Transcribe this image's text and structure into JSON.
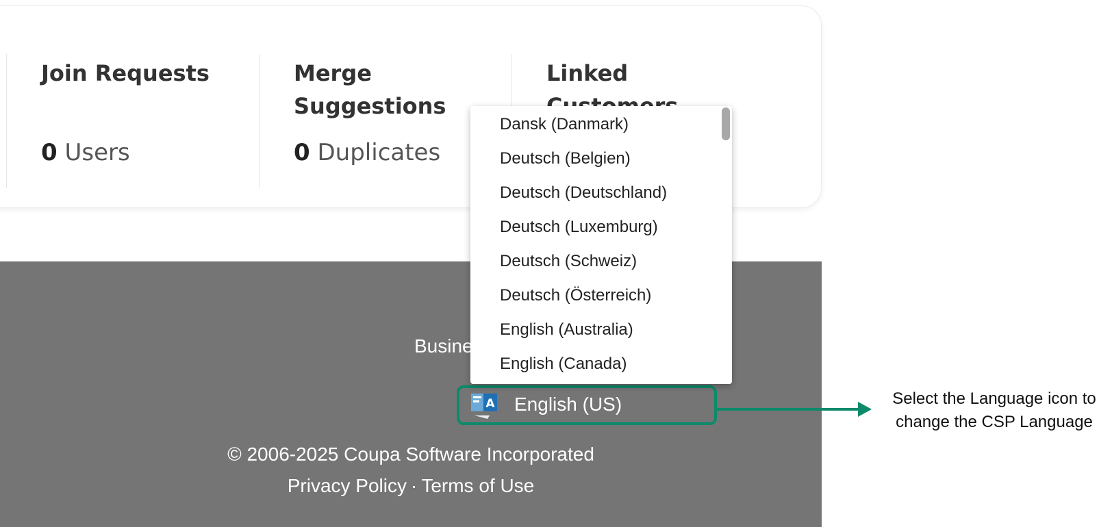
{
  "stats": [
    {
      "title": "Join Requests",
      "count": "0",
      "unit": "Users"
    },
    {
      "title": "Merge Suggestions",
      "count": "0",
      "unit": "Duplicates"
    },
    {
      "title": "Linked Customers",
      "count": "",
      "unit": ""
    }
  ],
  "footer": {
    "business_text": "Busine",
    "language_selector": {
      "current_language": "English (US)",
      "icon": "language-icon"
    },
    "copyright": "© 2006-2025 Coupa Software Incorporated",
    "links": {
      "privacy": "Privacy Policy",
      "separator": "·",
      "terms": "Terms of Use"
    }
  },
  "language_dropdown": {
    "options": [
      "Dansk (Danmark)",
      "Deutsch (Belgien)",
      "Deutsch (Deutschland)",
      "Deutsch (Luxemburg)",
      "Deutsch (Schweiz)",
      "Deutsch (Österreich)",
      "English (Australia)",
      "English (Canada)"
    ]
  },
  "annotation": {
    "text_line1": "Select the Language icon to",
    "text_line2": "change the CSP Language"
  },
  "colors": {
    "accent": "#0d8a6a",
    "footer_bg": "#757575"
  }
}
